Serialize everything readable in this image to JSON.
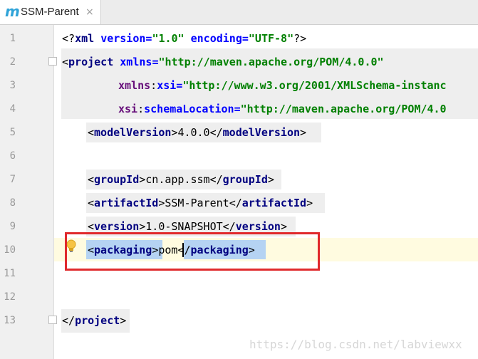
{
  "tab": {
    "icon": "m",
    "title": "SSM-Parent",
    "close": "×"
  },
  "gutter": {
    "line_numbers": [
      "1",
      "2",
      "3",
      "4",
      "5",
      "6",
      "7",
      "8",
      "9",
      "10",
      "11",
      "12",
      "13"
    ]
  },
  "code": {
    "l1": {
      "lt_q": "<?",
      "tag": "xml",
      "a1": "version",
      "eq1": "=",
      "v1": "\"1.0\"",
      "a2": "encoding",
      "eq2": "=",
      "v2": "\"UTF-8\"",
      "end": "?>"
    },
    "l2": {
      "lt": "<",
      "tag": "project",
      "attr": "xmlns",
      "eq": "=",
      "val": "\"http://maven.apache.org/POM/4.0.0\""
    },
    "l3": {
      "ns": "xmlns",
      "colon": ":",
      "attr": "xsi",
      "eq": "=",
      "val": "\"http://www.w3.org/2001/XMLSchema-instanc"
    },
    "l4": {
      "ns": "xsi",
      "colon": ":",
      "attr": "schemaLocation",
      "eq": "=",
      "val": "\"http://maven.apache.org/POM/4.0"
    },
    "l5": {
      "open": "modelVersion",
      "text": "4.0.0",
      "close": "modelVersion"
    },
    "l7": {
      "open": "groupId",
      "text": "cn.app.ssm",
      "close": "groupId"
    },
    "l8": {
      "open": "artifactId",
      "text": "SSM-Parent",
      "close": "artifactId"
    },
    "l9": {
      "open": "version",
      "text": "1.0-SNAPSHOT",
      "close": "version"
    },
    "l10": {
      "open": "packaging",
      "text": "pom",
      "close": "packaging"
    },
    "l13": {
      "close": "project"
    }
  },
  "watermark": "https://blog.csdn.net/labviewxx",
  "colors": {
    "tag": "#000080",
    "attribute": "#0000ff",
    "value": "#008000",
    "annotation_box": "#e0292c",
    "tag_match_highlight": "#b5d3f3"
  },
  "icons": [
    "maven-file-icon",
    "close-icon",
    "intention-bulb-icon",
    "fold-marker-icon"
  ]
}
